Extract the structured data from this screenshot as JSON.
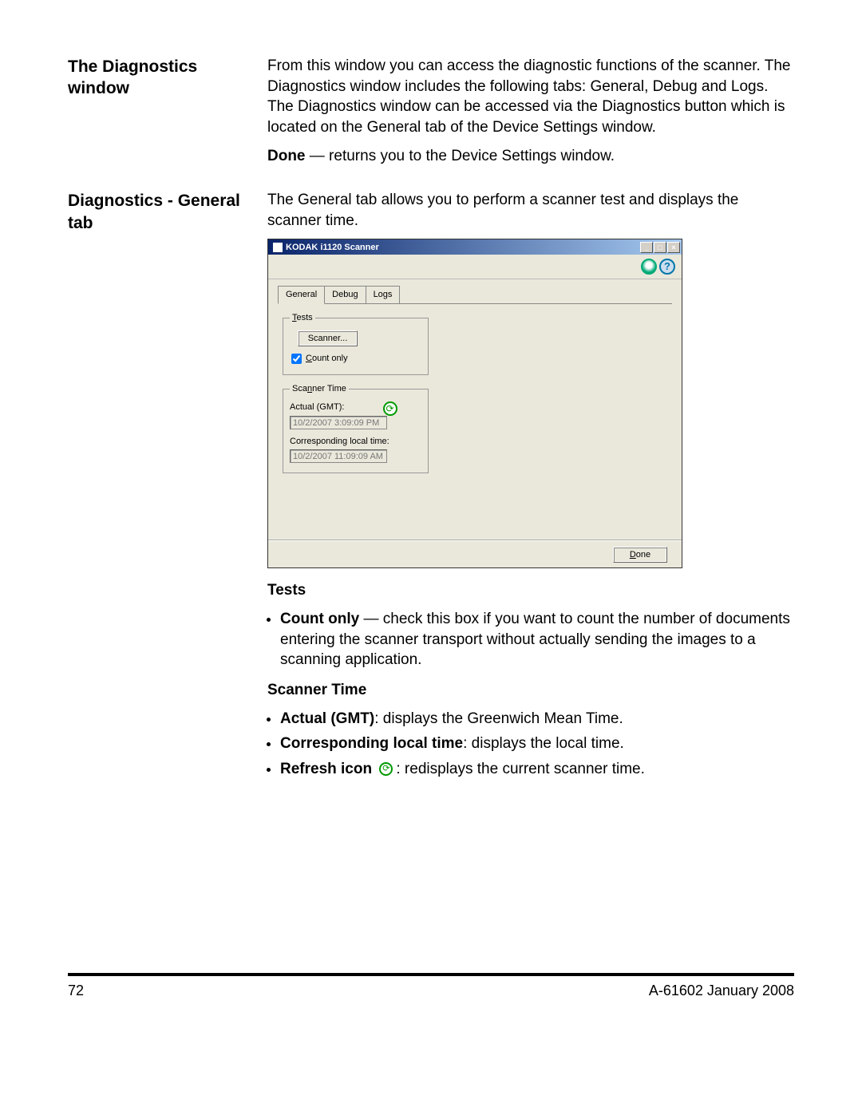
{
  "sections": {
    "diagWindow": {
      "heading": "The Diagnostics window",
      "para1": "From this window you can access the diagnostic functions of the scanner. The Diagnostics window includes the following tabs: General, Debug and Logs. The Diagnostics window can be accessed via the Diagnostics button which is located on the General tab of the Device Settings window.",
      "doneLabel": "Done",
      "doneText": " — returns you to the Device Settings window."
    },
    "generalTab": {
      "heading": "Diagnostics - General tab",
      "para1": "The General tab allows you to perform a scanner test and displays the scanner time."
    }
  },
  "appWindow": {
    "title": "KODAK i1120 Scanner",
    "winControls": {
      "min": "_",
      "max": "□",
      "close": "×"
    },
    "helpGlyph": "?",
    "tabs": [
      "General",
      "Debug",
      "Logs"
    ],
    "testsGroup": {
      "legend": "Tests",
      "legendAccessKey": "T",
      "scannerBtn": "Scanner...",
      "countOnlyLabel": "Count only",
      "countOnlyAccessKey": "C",
      "countOnlyChecked": true
    },
    "timeGroup": {
      "legend": "Scanner Time",
      "legendAccessKey": "n",
      "actualLabel": "Actual (GMT):",
      "actualValue": "10/2/2007 3:09:09 PM",
      "localLabel": "Corresponding local time:",
      "localValue": "10/2/2007 11:09:09 AM"
    },
    "doneBtn": "Done",
    "doneAccessKey": "D"
  },
  "belowText": {
    "testsHeading": "Tests",
    "countOnlyLabel": "Count only",
    "countOnlyText": " — check this box if you want to count the number of documents entering the scanner transport without actually sending the images to a scanning application.",
    "scannerTimeHeading": "Scanner Time",
    "actualLabel": "Actual (GMT)",
    "actualText": ": displays the Greenwich Mean Time.",
    "localLabel": "Corresponding local time",
    "localText": ": displays the local time.",
    "refreshLabel": "Refresh icon",
    "refreshText": ": redisplays the current scanner time."
  },
  "footer": {
    "pageNum": "72",
    "docRef": "A-61602  January 2008"
  }
}
